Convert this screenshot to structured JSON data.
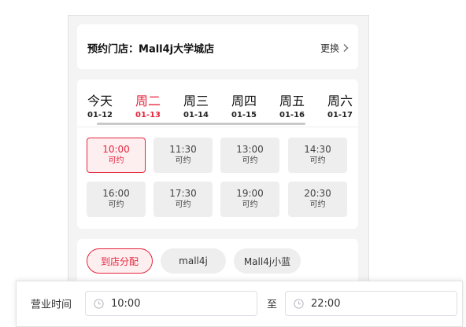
{
  "store": {
    "label": "预约门店：",
    "name": "Mall4j大学城店",
    "change_label": "更换"
  },
  "date_tabs": [
    {
      "day": "今天",
      "date": "01-12",
      "active": false
    },
    {
      "day": "周二",
      "date": "01-13",
      "active": true
    },
    {
      "day": "周三",
      "date": "01-14",
      "active": false
    },
    {
      "day": "周四",
      "date": "01-15",
      "active": false
    },
    {
      "day": "周五",
      "date": "01-16",
      "active": false
    },
    {
      "day": "周六",
      "date": "01-17",
      "active": false
    }
  ],
  "time_slots": [
    {
      "time": "10:00",
      "status": "可约",
      "selected": true
    },
    {
      "time": "11:30",
      "status": "可约",
      "selected": false
    },
    {
      "time": "13:00",
      "status": "可约",
      "selected": false
    },
    {
      "time": "14:30",
      "status": "可约",
      "selected": false
    },
    {
      "time": "16:00",
      "status": "可约",
      "selected": false
    },
    {
      "time": "17:30",
      "status": "可约",
      "selected": false
    },
    {
      "time": "19:00",
      "status": "可约",
      "selected": false
    },
    {
      "time": "20:30",
      "status": "可约",
      "selected": false
    }
  ],
  "staff_options": [
    {
      "label": "到店分配",
      "selected": true
    },
    {
      "label": "mall4j",
      "selected": false
    },
    {
      "label": "Mall4j小蓝",
      "selected": false
    }
  ],
  "business_hours": {
    "label": "营业时间",
    "start": "10:00",
    "separator": "至",
    "end": "22:00"
  },
  "colors": {
    "accent": "#e5263d",
    "selected_bg": "#fdeef0",
    "slot_bg": "#eeeeee",
    "page_bg": "#f4f4f4"
  },
  "icons": {
    "change": "chevron-right-icon",
    "time_input": "clock-icon"
  }
}
